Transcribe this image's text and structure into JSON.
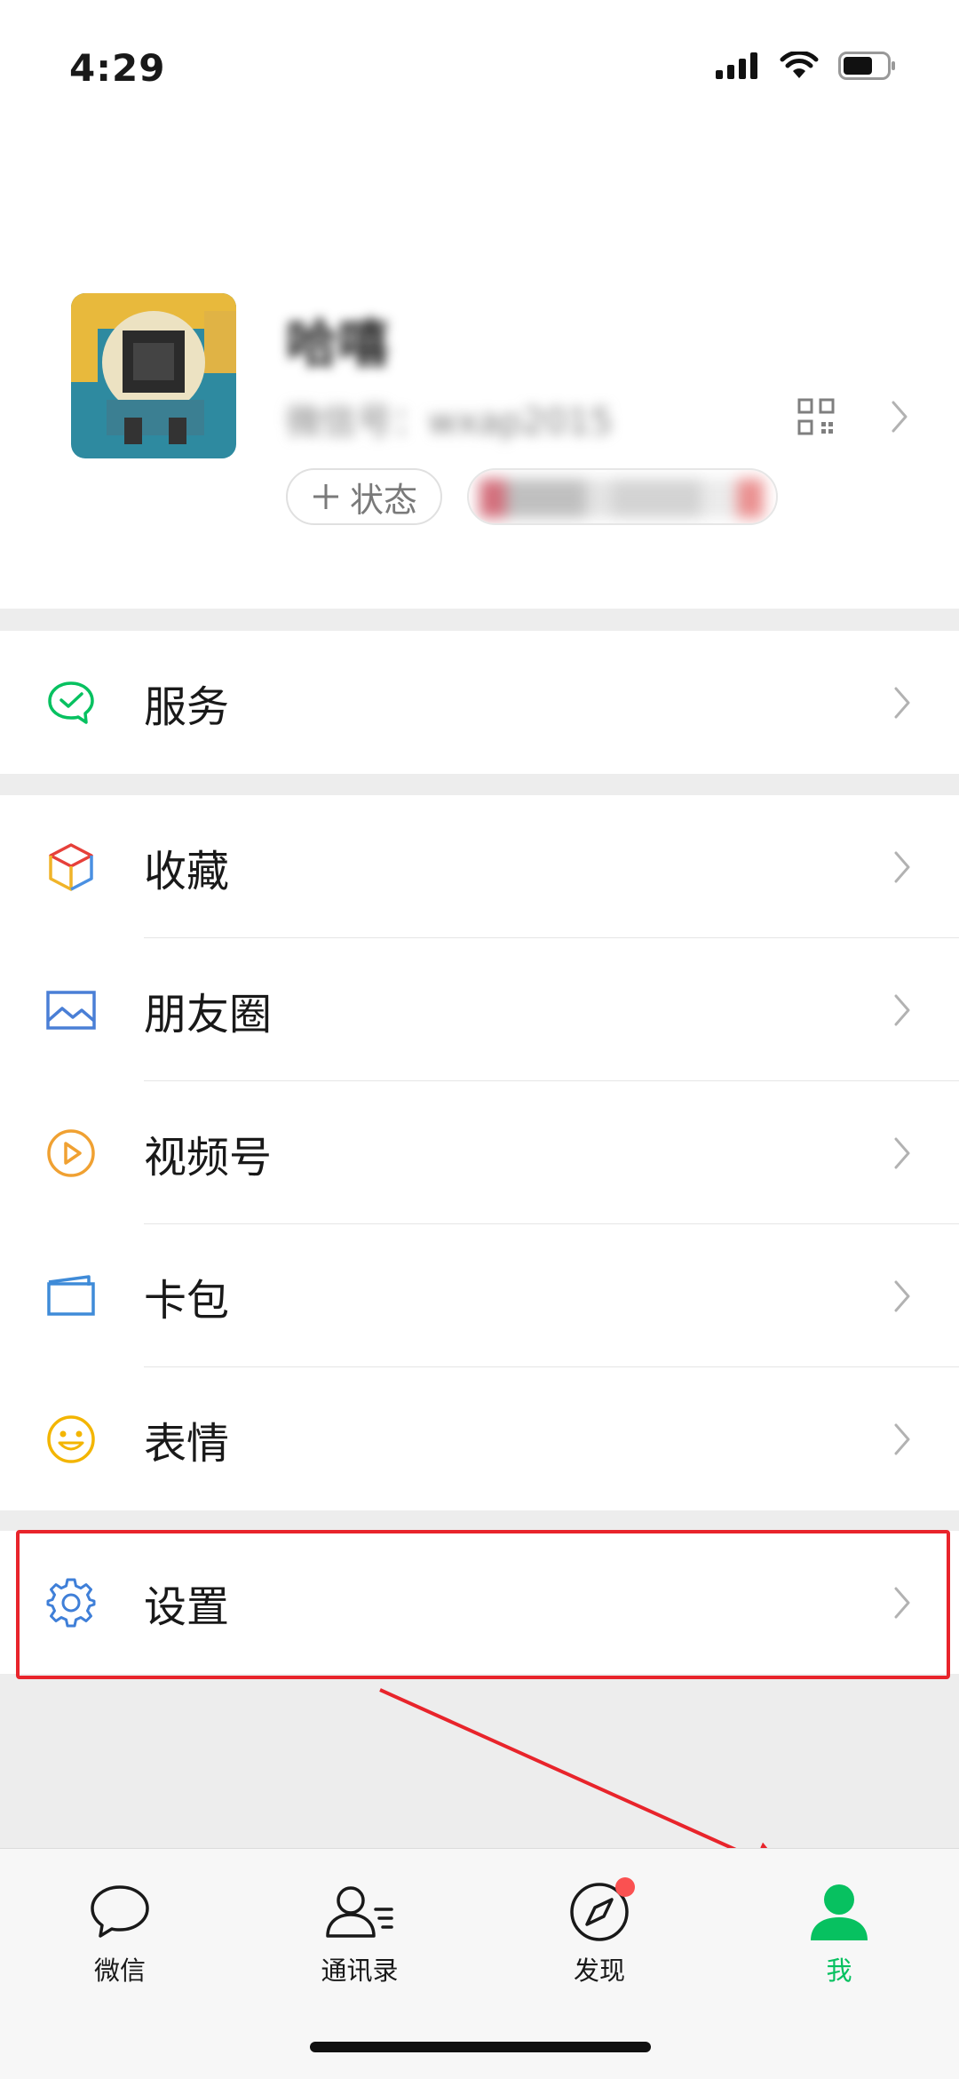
{
  "status_bar": {
    "time": "4:29"
  },
  "profile": {
    "nickname": "哈嘻",
    "wechat_id": "微信号：wxap2015",
    "status_button": "状态",
    "friend_status": "3个朋友"
  },
  "menu": {
    "services": "服务",
    "favorites": "收藏",
    "moments": "朋友圈",
    "channels": "视频号",
    "cards": "卡包",
    "stickers": "表情",
    "settings": "设置"
  },
  "tabbar": {
    "chats": "微信",
    "contacts": "通讯录",
    "discover": "发现",
    "me": "我"
  },
  "colors": {
    "accent": "#07c160",
    "highlight": "#e8242b",
    "badge": "#fa5151"
  }
}
